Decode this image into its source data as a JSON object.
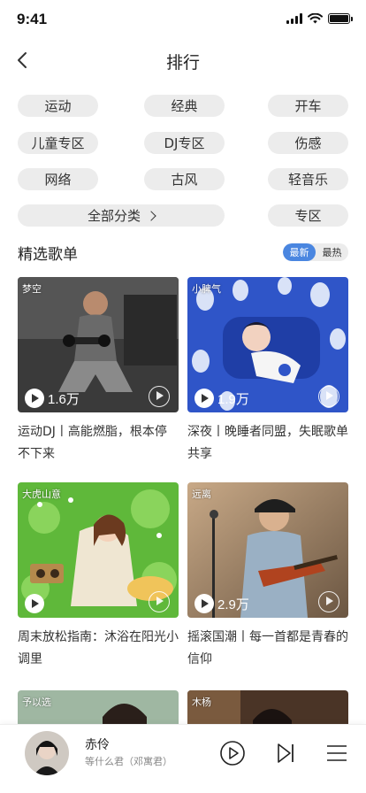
{
  "status": {
    "time": "9:41"
  },
  "nav": {
    "title": "排行"
  },
  "categories": [
    "运动",
    "经典",
    "开车",
    "儿童专区",
    "DJ专区",
    "伤感",
    "网络",
    "古风",
    "轻音乐",
    "全部分类",
    "专区"
  ],
  "section": {
    "title": "精选歌单",
    "sort_options": [
      "最新",
      "最热"
    ],
    "active_sort": "最新"
  },
  "playlists": [
    {
      "tag": "梦空",
      "plays": "1.6万",
      "title": "运动DJ丨高能燃脂，根本停不下来"
    },
    {
      "tag": "小脾气",
      "plays": "1.9万",
      "title": "深夜丨晚睡者同盟，失眠歌单共享"
    },
    {
      "tag": "大虎山意",
      "plays": "",
      "title": "周末放松指南：沐浴在阳光小调里"
    },
    {
      "tag": "远离",
      "plays": "2.9万",
      "title": "摇滚国潮丨每一首都是青春的信仰"
    },
    {
      "tag": "予以选",
      "plays": "",
      "title": ""
    },
    {
      "tag": "木杨",
      "plays": "",
      "title": ""
    }
  ],
  "player": {
    "song": "赤伶",
    "artist": "等什么君（邓寓君）"
  },
  "colors": {
    "accent": "#4a86e0",
    "chip_bg": "#ececec"
  }
}
